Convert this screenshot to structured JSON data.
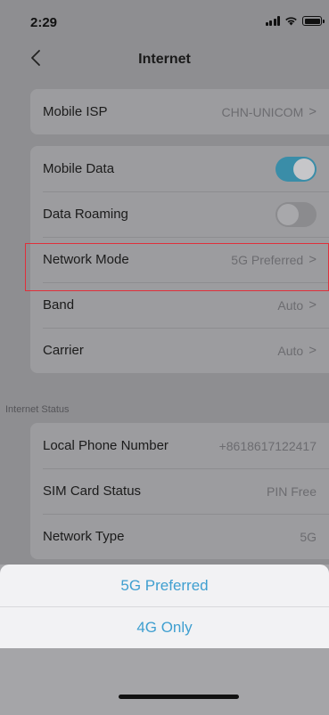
{
  "status_bar": {
    "time": "2:29"
  },
  "nav": {
    "title": "Internet"
  },
  "group1": {
    "rows": [
      {
        "label": "Mobile ISP",
        "value": "CHN-UNICOM",
        "chevron": ">"
      }
    ]
  },
  "group2": {
    "rows": [
      {
        "label": "Mobile Data",
        "toggle": "on"
      },
      {
        "label": "Data Roaming",
        "toggle": "off"
      },
      {
        "label": "Network Mode",
        "value": "5G Preferred",
        "chevron": ">"
      },
      {
        "label": "Band",
        "value": "Auto",
        "chevron": ">"
      },
      {
        "label": "Carrier",
        "value": "Auto",
        "chevron": ">"
      }
    ]
  },
  "internet_status": {
    "header": "Internet Status",
    "rows": [
      {
        "label": "Local Phone Number",
        "value": "+8618617122417"
      },
      {
        "label": "SIM Card Status",
        "value": "PIN Free"
      },
      {
        "label": "Network Type",
        "value": "5G"
      }
    ]
  },
  "action_sheet": {
    "options": [
      "5G Preferred",
      "4G Only"
    ]
  },
  "colors": {
    "accent": "#3f9fd0",
    "toggle_on": "#3a8da8",
    "highlight": "#e0303a"
  }
}
